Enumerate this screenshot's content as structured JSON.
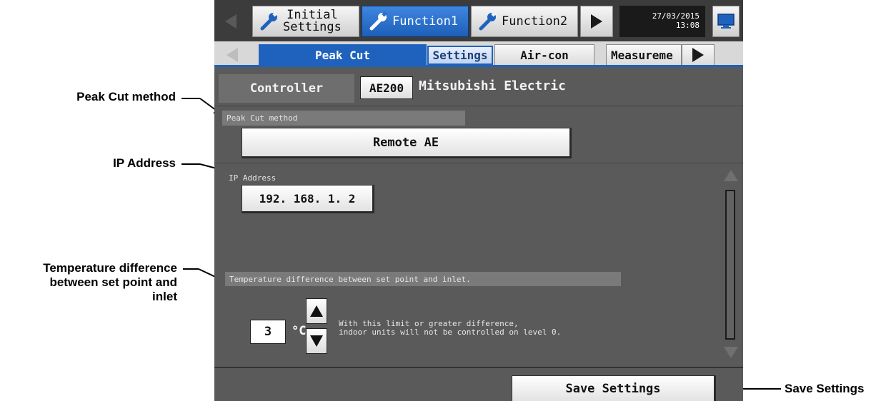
{
  "callouts": {
    "peak_cut_method": "Peak Cut method",
    "ip_address": "IP Address",
    "temp_diff": [
      "Temperature difference",
      "between set point and",
      "inlet"
    ],
    "save_settings": "Save Settings"
  },
  "topbar": {
    "tabs": [
      {
        "label_line1": "Initial",
        "label_line2": "Settings",
        "icon": "wrench-icon"
      },
      {
        "label": "Function1",
        "icon": "wrench-icon",
        "active": true
      },
      {
        "label": "Function2",
        "icon": "wrench-icon"
      }
    ],
    "date": "27/03/2015",
    "time": "13:08"
  },
  "subbar": {
    "tabs": [
      "Peak Cut",
      "Settings",
      "Air-con",
      "Measureme"
    ]
  },
  "controller": {
    "label": "Controller",
    "model": "AE200",
    "name": "Mitsubishi Electric"
  },
  "peak_cut": {
    "section_label": "Peak Cut method",
    "value": "Remote AE"
  },
  "ip": {
    "label": "IP Address",
    "value": "192. 168. 1. 2"
  },
  "temp": {
    "section_label": "Temperature difference between set point and inlet.",
    "value": "3",
    "unit": "°C",
    "hint_line1": "With this limit or greater difference,",
    "hint_line2": "indoor units will not be controlled on level 0."
  },
  "footer": {
    "save_label": "Save Settings"
  },
  "colors": {
    "accent_blue": "#1e62bd",
    "screen_gray": "#5a5a5a",
    "topbar_dark": "#3c3c3c"
  }
}
